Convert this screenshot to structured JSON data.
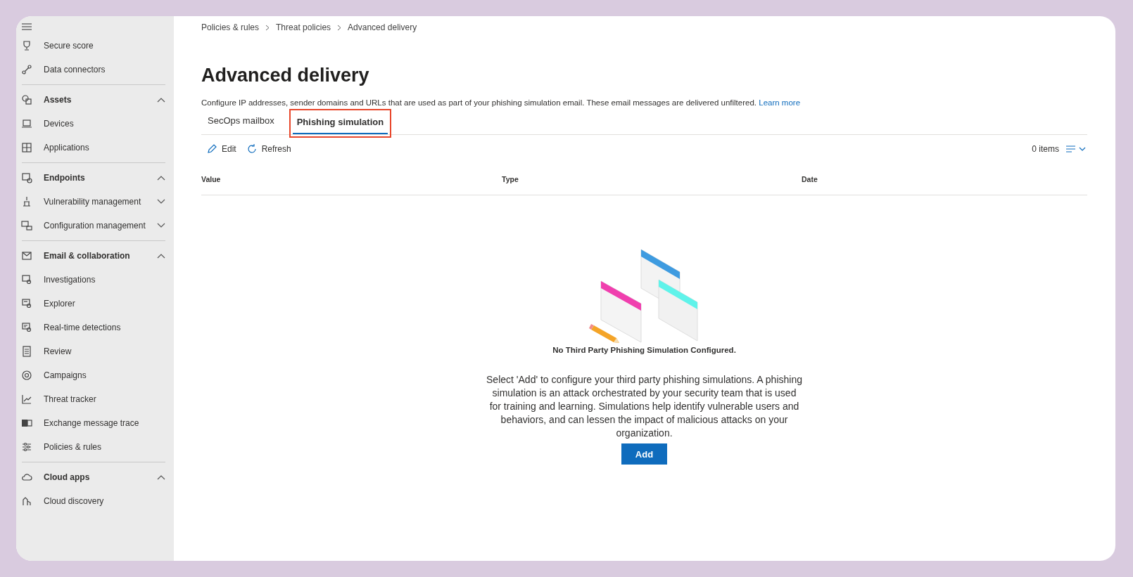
{
  "sidebar": {
    "groups": [
      {
        "items": [
          {
            "label": "Secure score"
          },
          {
            "label": "Data connectors"
          }
        ]
      },
      {
        "title": "Assets",
        "expanded": true,
        "items": [
          {
            "label": "Devices"
          },
          {
            "label": "Applications"
          }
        ]
      },
      {
        "title": "Endpoints",
        "expanded": true,
        "items": [
          {
            "label": "Vulnerability management",
            "expanded": false
          },
          {
            "label": "Configuration management",
            "expanded": false
          }
        ]
      },
      {
        "title": "Email & collaboration",
        "expanded": true,
        "items": [
          {
            "label": "Investigations"
          },
          {
            "label": "Explorer"
          },
          {
            "label": "Real-time detections"
          },
          {
            "label": "Review"
          },
          {
            "label": "Campaigns"
          },
          {
            "label": "Threat tracker"
          },
          {
            "label": "Exchange message trace"
          },
          {
            "label": "Policies & rules"
          }
        ]
      },
      {
        "title": "Cloud apps",
        "expanded": true,
        "items": [
          {
            "label": "Cloud discovery"
          }
        ]
      }
    ]
  },
  "breadcrumb": [
    "Policies & rules",
    "Threat policies",
    "Advanced delivery"
  ],
  "page": {
    "title": "Advanced delivery",
    "description": "Configure IP addresses, sender domains and URLs that are used as part of your phishing simulation email. These email messages are delivered unfiltered.",
    "link": "Learn more"
  },
  "tabs": [
    {
      "label": "SecOps mailbox",
      "selected": false,
      "highlighted": false
    },
    {
      "label": "Phishing simulation",
      "selected": true,
      "highlighted": true
    }
  ],
  "toolbar": {
    "buttons": [
      {
        "kind": "edit",
        "label": "Edit"
      },
      {
        "kind": "refresh",
        "label": "Refresh"
      }
    ],
    "count": "0 items"
  },
  "table": {
    "columns": [
      "Value",
      "Type",
      "Date"
    ]
  },
  "empty_state": {
    "title": "No Third Party Phishing Simulation Configured.",
    "text": "Select 'Add' to configure your third party phishing simulations. A phishing simulation is an attack orchestrated by your security team that is used for training and learning. Simulations help identify vulnerable users and behaviors, and can lessen the impact of malicious attacks on your organization.",
    "button": "Add"
  }
}
